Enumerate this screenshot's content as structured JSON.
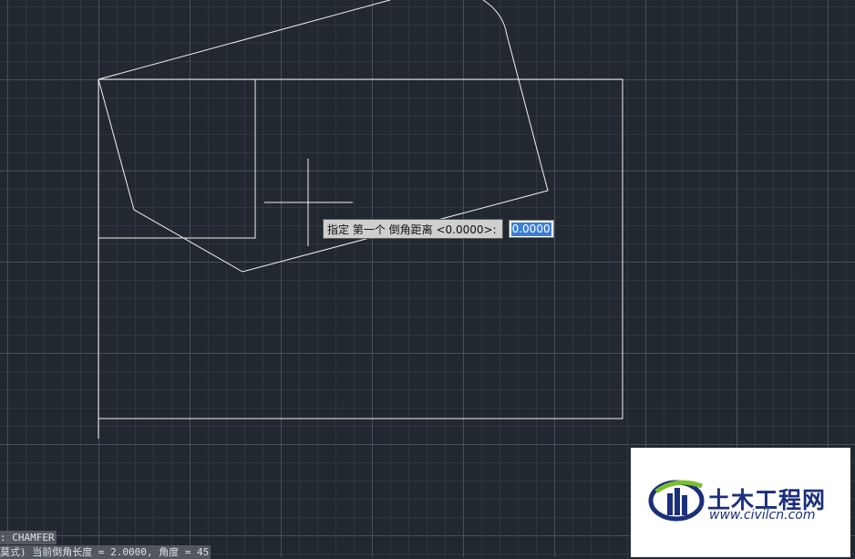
{
  "prompt": {
    "label": "指定 第一个 倒角距离 <0.0000>:",
    "value": "0.0000"
  },
  "command_history": {
    "line1": ":  CHAMFER",
    "line2": "莫式) 当前倒角长度 = 2.0000, 角度 = 45"
  },
  "watermark": {
    "title": "土木工程网",
    "url": "www.civilcn.com"
  },
  "icons": {
    "cursor": "crosshair-cursor-icon",
    "logo": "civilcn-logo-icon"
  },
  "colors": {
    "background": "#212830",
    "geometry": "#ffffff",
    "selection": "#3b7ed6",
    "logo_blue": "#1b2f7a",
    "logo_green": "#7bbf2a"
  }
}
